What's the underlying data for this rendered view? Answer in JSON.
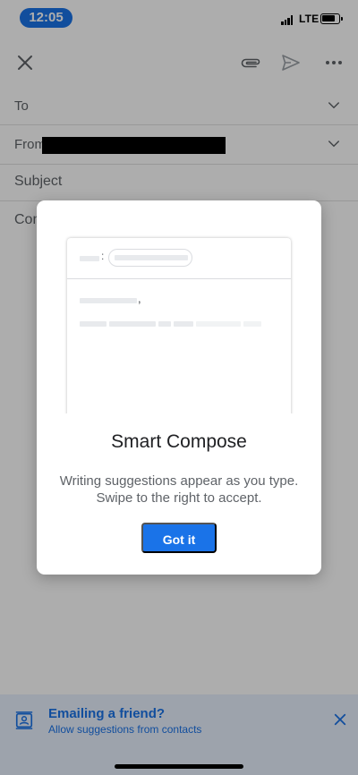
{
  "status": {
    "time": "12:05",
    "network": "LTE"
  },
  "toolbar": {
    "close_icon": "close-icon",
    "attach_icon": "paperclip-icon",
    "send_icon": "send-icon",
    "more_icon": "more-vert-icon"
  },
  "compose": {
    "to_label": "To",
    "from_label": "From",
    "subject_label": "Subject",
    "body_placeholder": "Compose email"
  },
  "dialog": {
    "title": "Smart Compose",
    "body": "Writing suggestions appear as you type. Swipe to the right to accept.",
    "button_label": "Got it"
  },
  "banner": {
    "title": "Emailing a friend?",
    "subtitle": "Allow suggestions from contacts",
    "icon": "contact-icon",
    "dismiss_icon": "close-icon"
  },
  "colors": {
    "accent": "#1a73e8",
    "banner_bg": "#e8f0fe",
    "scrim": "rgba(0,0,0,0.32)"
  }
}
